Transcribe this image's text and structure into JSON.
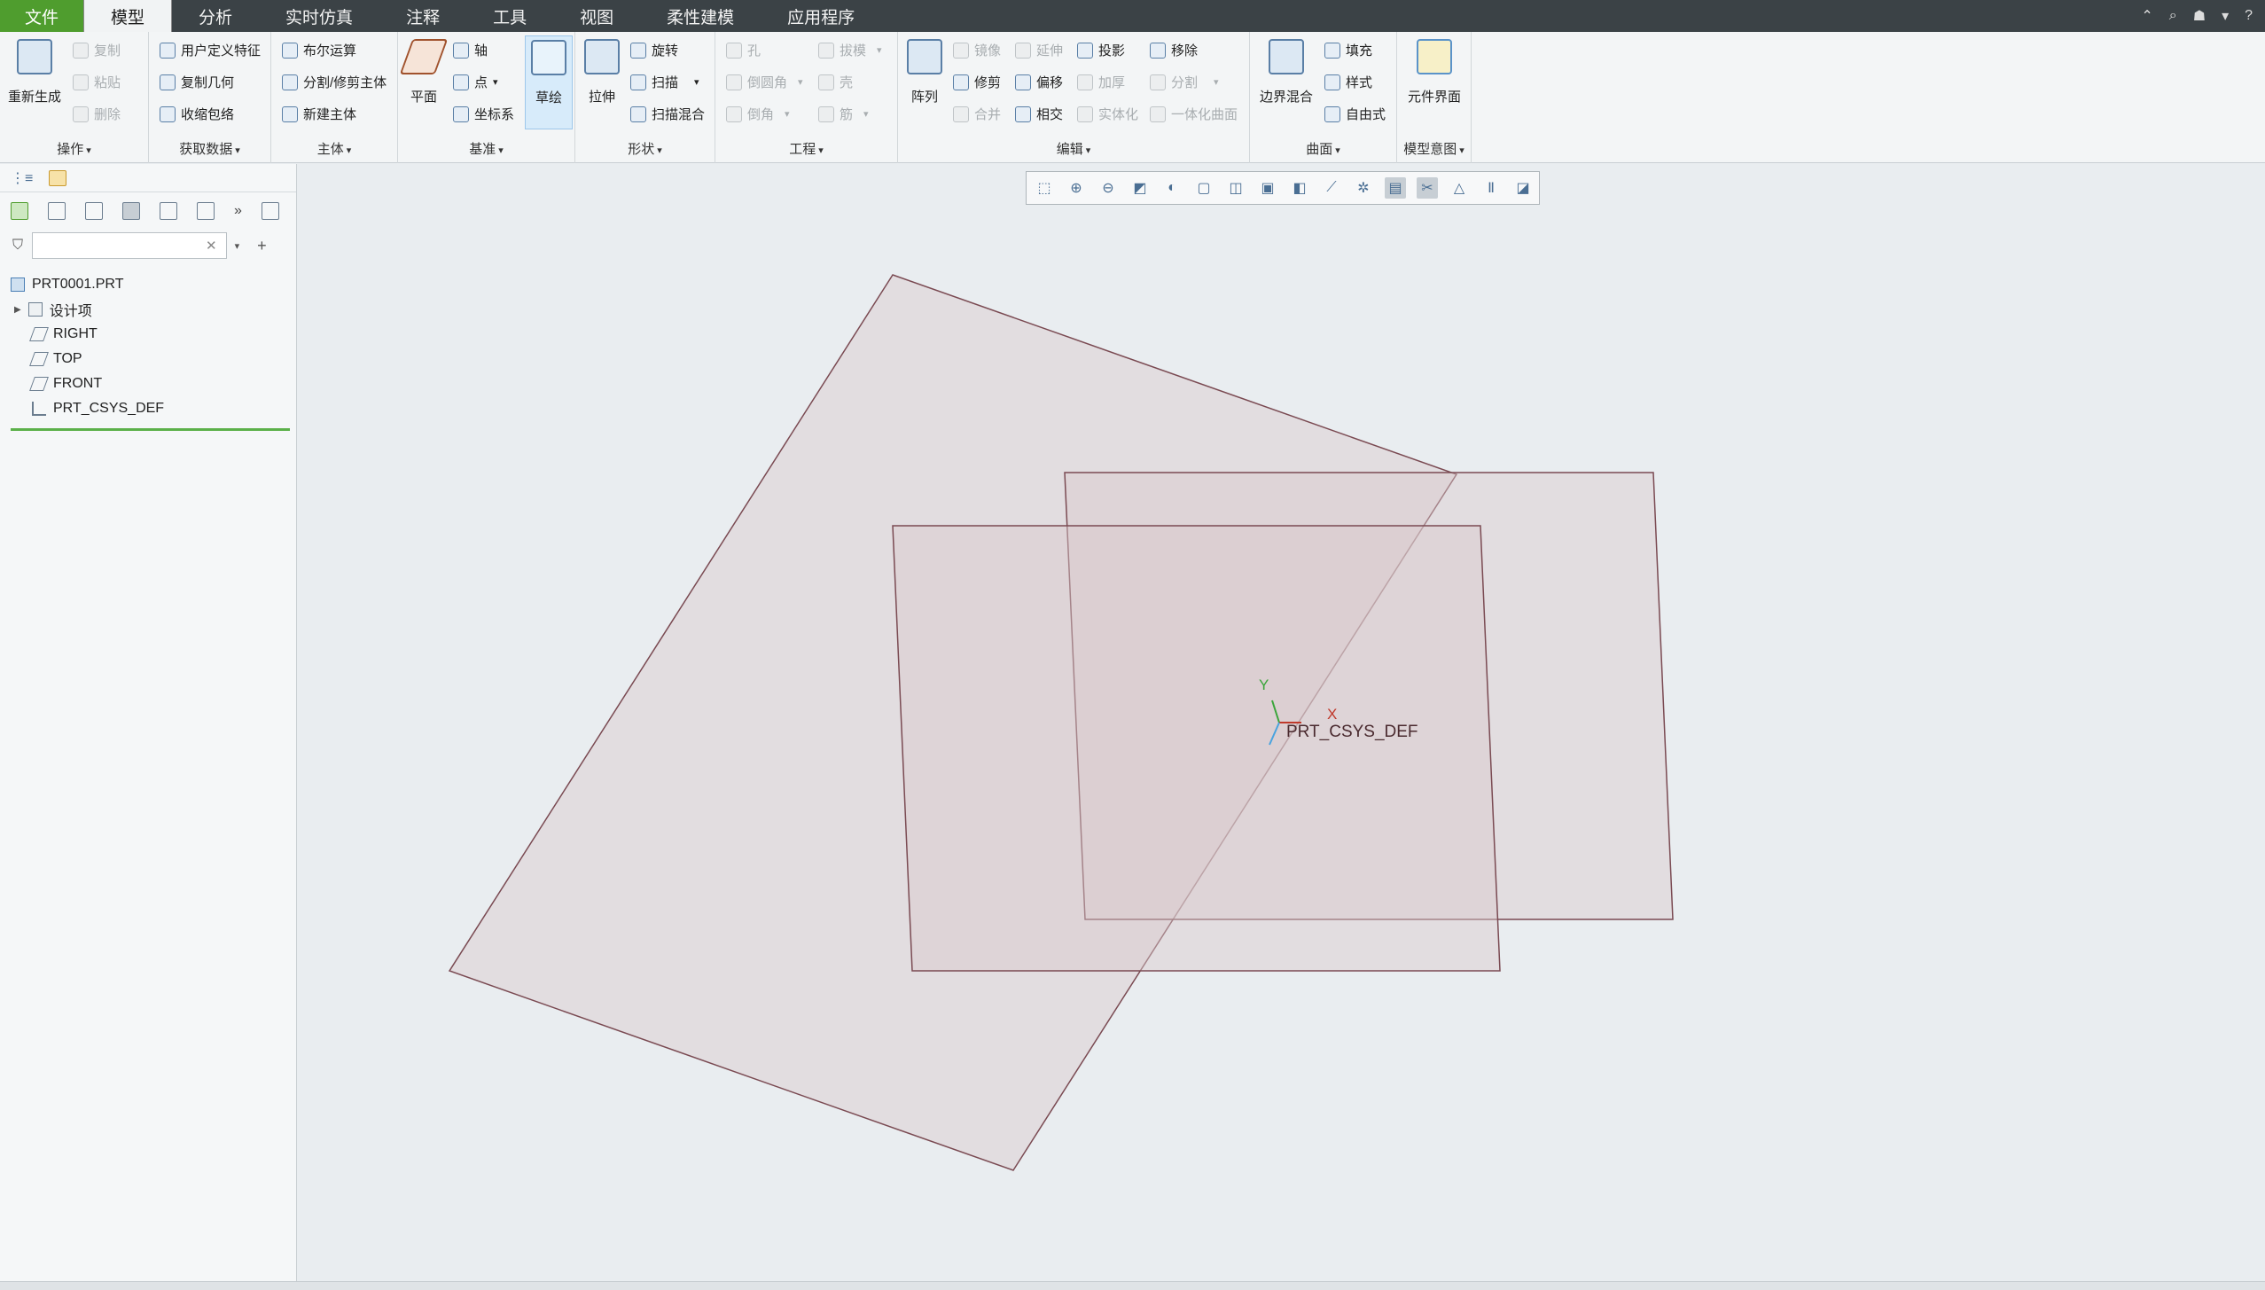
{
  "menu": {
    "tabs": [
      "文件",
      "模型",
      "分析",
      "实时仿真",
      "注释",
      "工具",
      "视图",
      "柔性建模",
      "应用程序"
    ],
    "active": "模型"
  },
  "ribbon": {
    "groups": {
      "operations": "操作",
      "get_data": "获取数据",
      "body": "主体",
      "datum": "基准",
      "shapes": "形状",
      "engineering": "工程",
      "editing": "编辑",
      "surfaces": "曲面",
      "model_intent": "模型意图"
    },
    "buttons": {
      "regenerate": "重新生成",
      "copy": "复制",
      "paste": "粘贴",
      "delete": "删除",
      "udf": "用户定义特征",
      "copy_geometry": "复制几何",
      "shrinkwrap": "收缩包络",
      "boolean": "布尔运算",
      "split_trim_body": "分割/修剪主体",
      "new_body": "新建主体",
      "plane": "平面",
      "axis": "轴",
      "point": "点",
      "csys": "坐标系",
      "sketch": "草绘",
      "extrude": "拉伸",
      "revolve": "旋转",
      "sweep": "扫描",
      "swept_blend": "扫描混合",
      "hole": "孔",
      "round": "倒圆角",
      "chamfer": "倒角",
      "draft": "拔模",
      "shell": "壳",
      "rib": "筋",
      "pattern": "阵列",
      "mirror": "镜像",
      "trim": "修剪",
      "merge": "合并",
      "extend": "延伸",
      "offset": "偏移",
      "intersect": "相交",
      "project": "投影",
      "thicken": "加厚",
      "solidify": "实体化",
      "remove": "移除",
      "split": "分割",
      "unify_surfaces": "一体化曲面",
      "boundary_blend": "边界混合",
      "fill": "填充",
      "style": "样式",
      "freestyle": "自由式",
      "component_interface": "元件界面"
    }
  },
  "model_tree": {
    "search_value": "",
    "items": [
      {
        "label": "PRT0001.PRT",
        "icon": "part-icon"
      },
      {
        "label": "设计项",
        "icon": "design-items-icon"
      },
      {
        "label": "RIGHT",
        "icon": "datum-plane-icon"
      },
      {
        "label": "TOP",
        "icon": "datum-plane-icon"
      },
      {
        "label": "FRONT",
        "icon": "datum-plane-icon"
      },
      {
        "label": "PRT_CSYS_DEF",
        "icon": "csys-icon"
      }
    ]
  },
  "viewport": {
    "csys_label": "PRT_CSYS_DEF",
    "axis_x": "X",
    "axis_y": "Y"
  },
  "colors": {
    "file_tab": "#4f9d2e",
    "menubar": "#3b4246",
    "datum_plane_fill": "#d9c9cb",
    "datum_plane_edge": "#7a4a52",
    "axis_x": "#c0392b",
    "axis_y": "#3aa53a",
    "axis_z": "#4aa3df"
  }
}
